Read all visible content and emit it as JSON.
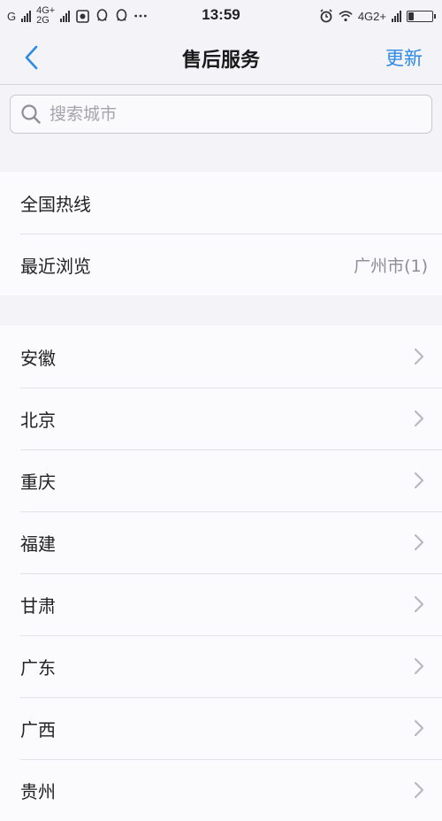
{
  "status_bar": {
    "carrier1": "G",
    "net_top": "4G+",
    "net_bottom": "2G",
    "time": "13:59",
    "net_right": "4G2+"
  },
  "nav": {
    "back_icon": "chevron-left-icon",
    "title": "售后服务",
    "action": "更新",
    "accent_color": "#2b8ae6"
  },
  "search": {
    "placeholder": "搜索城市",
    "value": ""
  },
  "quick": [
    {
      "label": "全国热线",
      "value": ""
    },
    {
      "label": "最近浏览",
      "value": "广州市(1)"
    }
  ],
  "provinces": [
    {
      "label": "安徽"
    },
    {
      "label": "北京"
    },
    {
      "label": "重庆"
    },
    {
      "label": "福建"
    },
    {
      "label": "甘肃"
    },
    {
      "label": "广东"
    },
    {
      "label": "广西"
    },
    {
      "label": "贵州"
    }
  ]
}
